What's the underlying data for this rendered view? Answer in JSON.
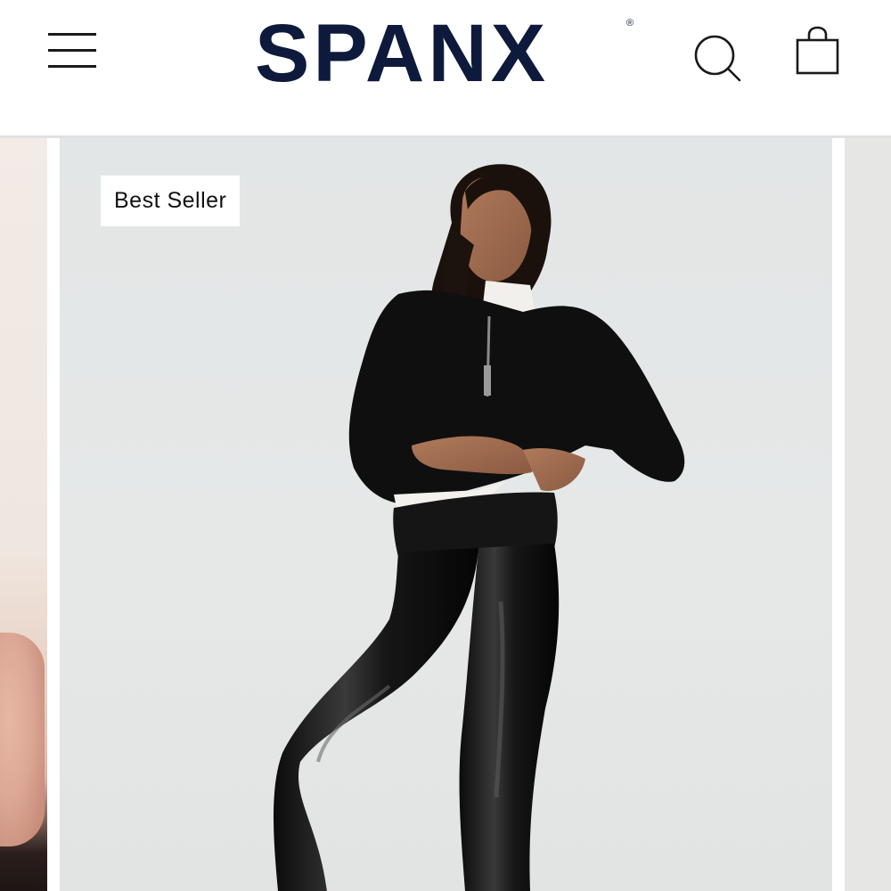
{
  "header": {
    "brand": "SPANX",
    "brand_mark": "®",
    "menu_icon": "hamburger-menu-icon",
    "search_icon": "search-icon",
    "bag_icon": "shopping-bag-icon",
    "brand_color": "#0e1a3c"
  },
  "carousel": {
    "current_slide": {
      "badge": "Best Seller"
    }
  }
}
